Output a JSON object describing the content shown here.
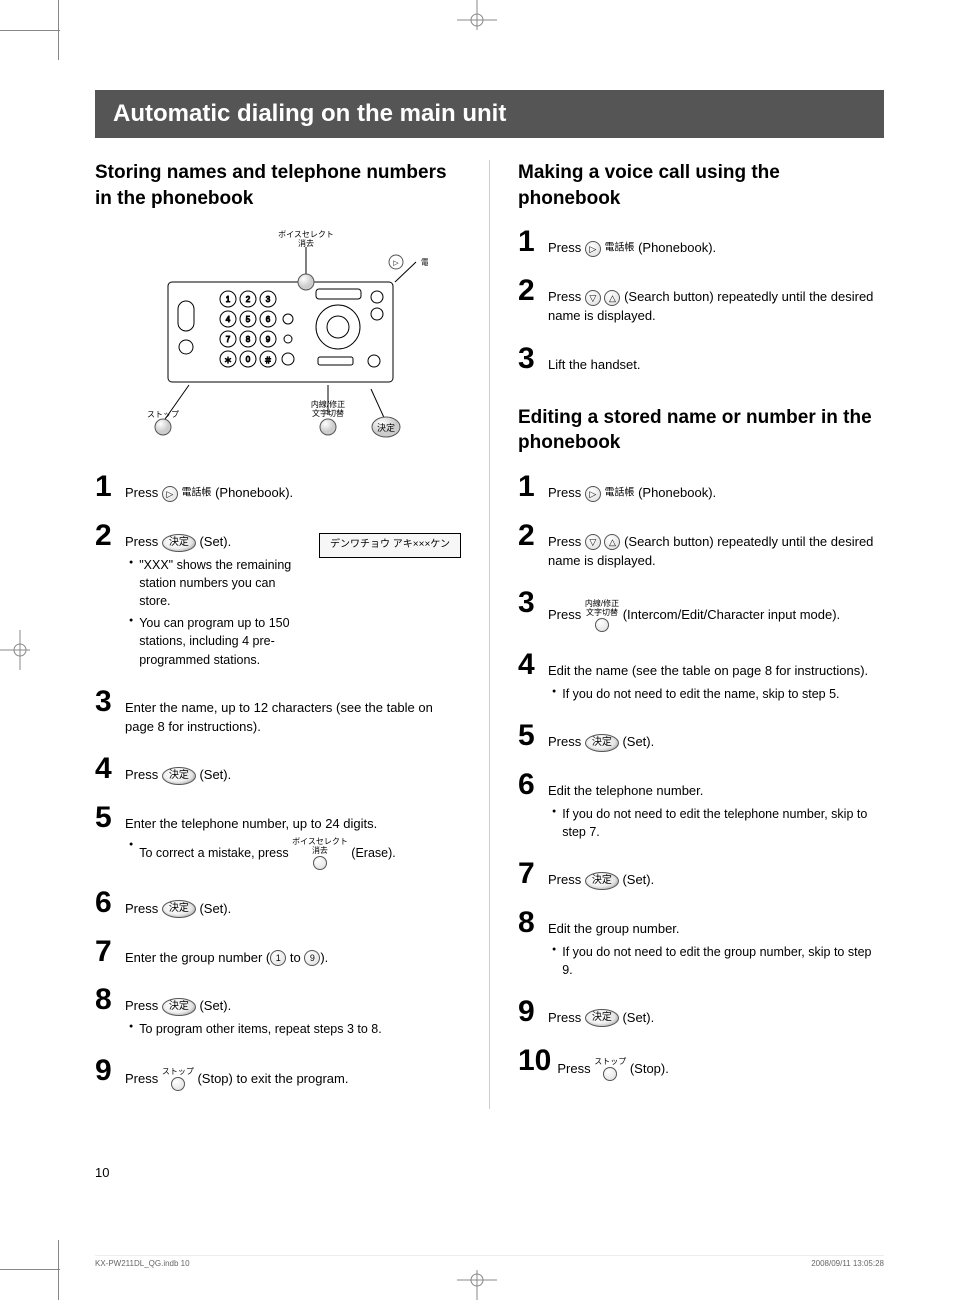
{
  "page_title": "Automatic dialing on the main unit",
  "page_number": "10",
  "footer_left": "KX-PW211DL_QG.indb   10",
  "footer_right": "2008/09/11   13:05:28",
  "left": {
    "heading": "Storing names and telephone numbers in the phonebook",
    "labels": {
      "voice_select_erase_jp": "ボイスセレクト\n消去",
      "phonebook_jp": "電話帳",
      "stop_jp": "ストップ",
      "intercom_edit_jp": "内線/修正\n文字切替",
      "set_jp": "決定"
    },
    "lcd_text": "デンワチョウ アキ×××ケン",
    "steps": [
      {
        "n": "1",
        "text_a": "Press ",
        "btn_round_tri": "▷",
        "btn_label": "電話帳",
        "text_b": " (Phonebook)."
      },
      {
        "n": "2",
        "text_a": "Press ",
        "btn_oval": "決定",
        "text_b": " (Set).",
        "bullets": [
          "\"XXX\" shows the remaining station numbers you can store.",
          "You can program up to 150 stations, including 4 pre-programmed stations."
        ],
        "show_lcd": true
      },
      {
        "n": "3",
        "plain": "Enter the name, up to 12 characters (see the table on page 8 for instructions)."
      },
      {
        "n": "4",
        "text_a": "Press ",
        "btn_oval": "決定",
        "text_b": " (Set)."
      },
      {
        "n": "5",
        "plain": "Enter the telephone number, up to 24 digits.",
        "bullets_btn": [
          {
            "pre": "To correct a mistake, press ",
            "stack_top": "ボイスセレクト",
            "stack_mid": "消去",
            "post": " (Erase)."
          }
        ]
      },
      {
        "n": "6",
        "text_a": "Press ",
        "btn_oval": "決定",
        "text_b": " (Set)."
      },
      {
        "n": "7",
        "plain_parts": [
          "Enter the group number (",
          " to ",
          ")."
        ],
        "digits": [
          "1",
          "9"
        ]
      },
      {
        "n": "8",
        "text_a": "Press ",
        "btn_oval": "決定",
        "text_b": " (Set).",
        "bullets": [
          "To program other items, repeat steps 3 to 8."
        ]
      },
      {
        "n": "9",
        "text_a": "Press ",
        "stack_top": "ストップ",
        "text_b": " (Stop) to exit the program."
      }
    ]
  },
  "right": {
    "section_a": {
      "heading": "Making a voice call using the phonebook",
      "steps": [
        {
          "n": "1",
          "text_a": "Press ",
          "btn_round_tri": "▷",
          "btn_label": "電話帳",
          "text_b": " (Phonebook)."
        },
        {
          "n": "2",
          "text_a": "Press ",
          "two_rounds": [
            "▽",
            "△"
          ],
          "text_b": " (Search button) repeatedly until the desired name is displayed."
        },
        {
          "n": "3",
          "plain": "Lift the handset."
        }
      ]
    },
    "section_b": {
      "heading": "Editing a stored name or number in the phonebook",
      "steps": [
        {
          "n": "1",
          "text_a": "Press ",
          "btn_round_tri": "▷",
          "btn_label": "電話帳",
          "text_b": " (Phonebook)."
        },
        {
          "n": "2",
          "text_a": "Press ",
          "two_rounds": [
            "▽",
            "△"
          ],
          "text_b": " (Search button) repeatedly until the desired name is displayed."
        },
        {
          "n": "3",
          "text_a": "Press ",
          "stack_top": "内線/修正",
          "stack_mid": "文字切替",
          "text_b": " (Intercom/Edit/Character input mode)."
        },
        {
          "n": "4",
          "plain": "Edit the name (see the table on page 8 for instructions).",
          "bullets": [
            "If you do not need to edit the name, skip to step 5."
          ]
        },
        {
          "n": "5",
          "text_a": "Press ",
          "btn_oval": "決定",
          "text_b": " (Set)."
        },
        {
          "n": "6",
          "plain": "Edit the telephone number.",
          "bullets": [
            "If you do not need to edit the telephone number, skip to step 7."
          ]
        },
        {
          "n": "7",
          "text_a": "Press ",
          "btn_oval": "決定",
          "text_b": " (Set)."
        },
        {
          "n": "8",
          "plain": "Edit the group number.",
          "bullets": [
            "If you do not need to edit the group number, skip to step 9."
          ]
        },
        {
          "n": "9",
          "text_a": "Press ",
          "btn_oval": "決定",
          "text_b": " (Set)."
        },
        {
          "n": "10",
          "text_a": "Press ",
          "stack_top": "ストップ",
          "text_b": " (Stop)."
        }
      ]
    }
  }
}
